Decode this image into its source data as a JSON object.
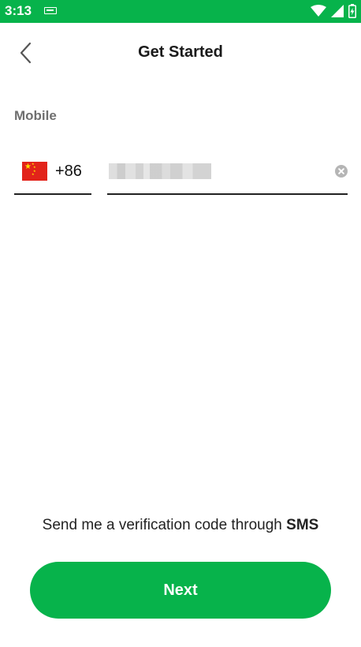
{
  "status_bar": {
    "time": "3:13",
    "background_color": "#07b34b",
    "icons": [
      "keyboard-icon",
      "wifi-icon",
      "signal-icon",
      "battery-icon"
    ]
  },
  "header": {
    "title": "Get Started",
    "back_icon": "chevron-left-icon"
  },
  "form": {
    "mobile_label": "Mobile",
    "country": {
      "flag_icon": "china-flag-icon",
      "code": "+86"
    },
    "phone": {
      "value": "",
      "masked": true,
      "clear_icon": "clear-circle-icon"
    }
  },
  "sms_prompt": {
    "text": "Send me a verification code through ",
    "link": "SMS"
  },
  "next_button": {
    "label": "Next",
    "color": "#07b34b"
  }
}
